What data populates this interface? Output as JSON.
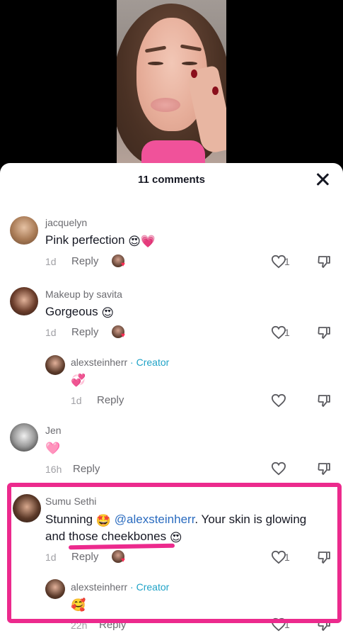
{
  "sheet": {
    "title": "11 comments"
  },
  "comments": [
    {
      "username": "jacquelyn",
      "text": "Pink perfection",
      "emojis": [
        "😍",
        "💗"
      ],
      "age": "1d",
      "reply_label": "Reply",
      "likes": "1"
    },
    {
      "username": "Makeup by savita",
      "text": "Gorgeous",
      "emojis": [
        "😍"
      ],
      "age": "1d",
      "reply_label": "Reply",
      "likes": "1"
    },
    {
      "username": "alexsteinherr",
      "badge": "· Creator",
      "text": "",
      "emojis": [
        "💞"
      ],
      "age": "1d",
      "reply_label": "Reply",
      "likes": ""
    },
    {
      "username": "Jen",
      "text": "",
      "emojis": [
        "🩷"
      ],
      "age": "16h",
      "reply_label": "Reply",
      "likes": ""
    },
    {
      "username": "Sumu Sethi",
      "text_before": "Stunning",
      "emoji_mid": "🤩",
      "mention": "@alexsteinherr",
      "text_after": ". Your skin is glowing",
      "text_line2": "and those cheekbones",
      "emoji_end": "😍",
      "age": "1d",
      "reply_label": "Reply",
      "likes": "1"
    },
    {
      "username": "alexsteinherr",
      "badge": "· Creator",
      "text": "",
      "emojis": [
        "🥰"
      ],
      "age": "22h",
      "reply_label": "Reply",
      "likes": "1"
    }
  ],
  "colors": {
    "highlight": "#ec2a8d",
    "creator": "#20a3c7",
    "mention": "#2a6bbf"
  }
}
